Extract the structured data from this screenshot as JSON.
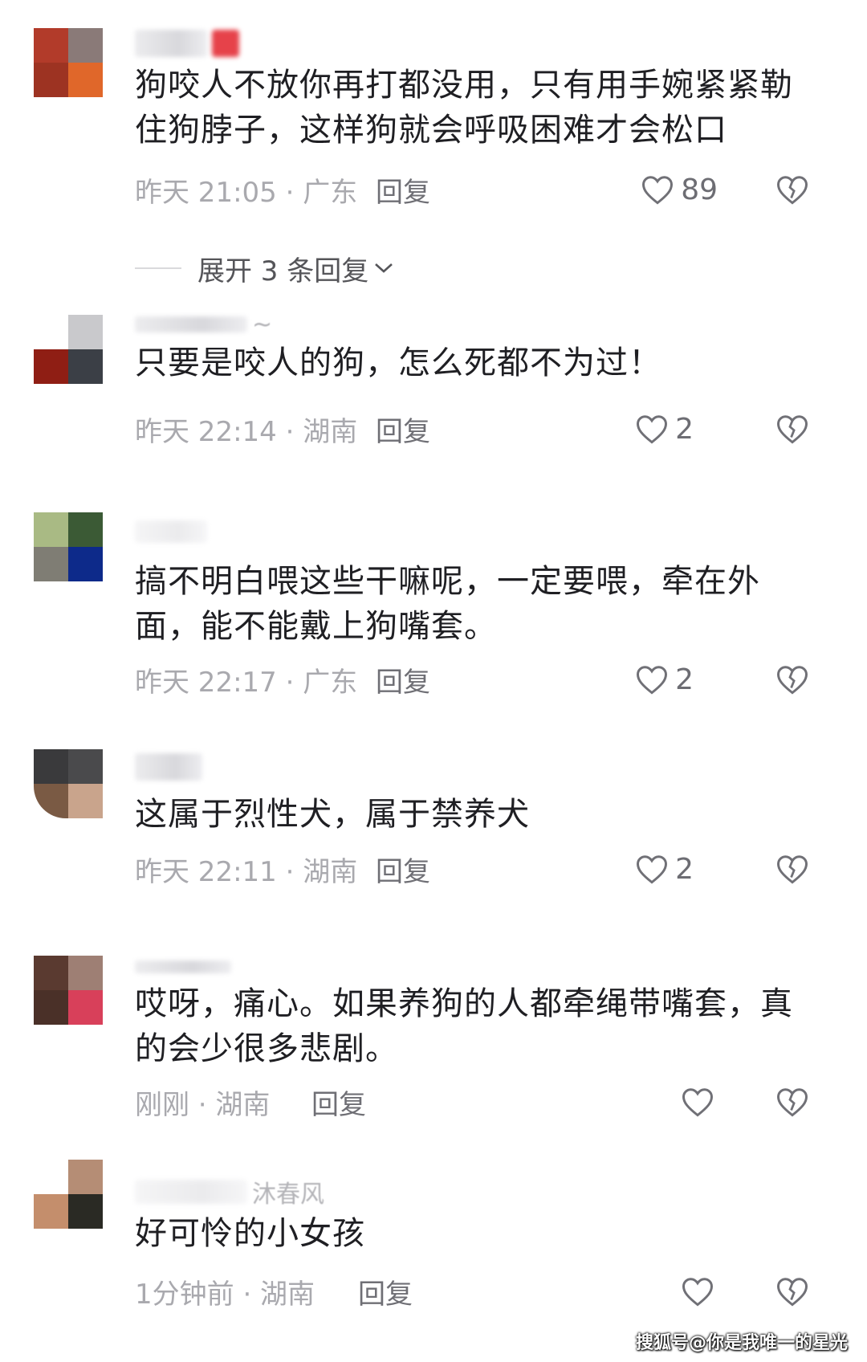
{
  "comments": [
    {
      "name_tail": "",
      "text": "狗咬人不放你再打都没用，只有用手婉紧紧勒\n住狗脖子，这样狗就会呼吸困难才会松口",
      "time": "昨天 21:05 · 广东",
      "reply": "回复",
      "likes": "89",
      "avatar_colors": [
        "#b23b2a",
        "#8a7a78",
        "#9d3322",
        "#e0672a"
      ]
    },
    {
      "name_tail": "~",
      "text": "只要是咬人的狗，怎么死都不为过！",
      "time": "昨天 22:14 · 湖南",
      "reply": "回复",
      "likes": "2",
      "avatar_colors": [
        "#ffffff",
        "#c9c9cc",
        "#8f1e14",
        "#3b3f46"
      ]
    },
    {
      "name_tail": "",
      "text": "搞不明白喂这些干嘛呢，一定要喂，牵在外\n面，能不能戴上狗嘴套。",
      "time": "昨天 22:17 · 广东",
      "reply": "回复",
      "likes": "2",
      "avatar_colors": [
        "#a9ba84",
        "#3b5a35",
        "#7f7d74",
        "#0d2a8a"
      ]
    },
    {
      "name_tail": "",
      "text": "这属于烈性犬，属于禁养犬",
      "time": "昨天 22:11 · 湖南",
      "reply": "回复",
      "likes": "2",
      "avatar_colors": [
        "#3a3a3c",
        "#4a4a4c",
        "#7a5a44",
        "#c9a48c"
      ]
    },
    {
      "name_tail": "",
      "text": "哎呀，痛心。如果养狗的人都牵绳带嘴套，真\n的会少很多悲剧。",
      "time": "刚刚 · 湖南",
      "reply": "回复",
      "likes": "",
      "avatar_colors": [
        "#5a3a30",
        "#9e7f74",
        "#4a3028",
        "#d8405a"
      ]
    },
    {
      "name_tail": "沐春风",
      "text": "好可怜的小女孩",
      "time": "1分钟前 · 湖南",
      "reply": "回复",
      "likes": "",
      "avatar_colors": [
        "#ffffff",
        "#b58d75",
        "#c48e6c",
        "#2a2a24"
      ]
    }
  ],
  "expand_replies": "展开 3 条回复",
  "watermark": "搜狐号@你是我唯一的星光",
  "icons": {
    "like": "heart-outline-icon",
    "dislike": "broken-heart-icon",
    "expand": "chevron-down-icon"
  },
  "colors": {
    "text": "#1f1f23",
    "meta": "#a9a9ae",
    "reply": "#6f6f75"
  }
}
